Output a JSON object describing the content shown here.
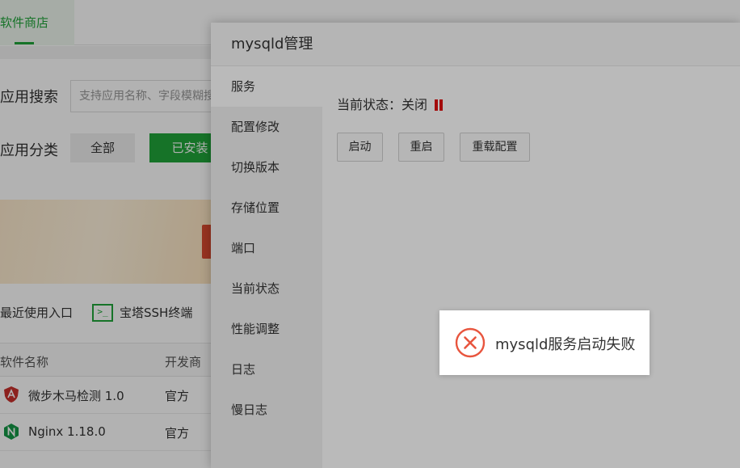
{
  "background": {
    "tab_label": "软件商店",
    "search_label": "应用搜索",
    "search_placeholder": "支持应用名称、字段模糊搜索",
    "category_label": "应用分类",
    "category_all": "全部",
    "category_installed": "已安装",
    "recent_entry": "最近使用入口",
    "ssh_icon_text": ">_",
    "ssh_label": "宝塔SSH终端",
    "table_headers": [
      "软件名称",
      "开发商"
    ],
    "rows": [
      {
        "name": "微步木马检测 1.0",
        "vendor": "官方",
        "icon": "shield-icon",
        "icon_color": "#c9302c"
      },
      {
        "name": "Nginx 1.18.0",
        "vendor": "官方",
        "icon": "nginx-icon",
        "icon_color": "#159947"
      }
    ],
    "accent_color": "#20a53a"
  },
  "dialog": {
    "title": "mysqld管理",
    "side_items": [
      "服务",
      "配置修改",
      "切换版本",
      "存储位置",
      "端口",
      "当前状态",
      "性能调整",
      "日志",
      "慢日志"
    ],
    "active_index": 0,
    "status_label": "当前状态：",
    "status_value": "关闭",
    "status_icon": "pause-icon",
    "status_color": "#e01010",
    "buttons": {
      "start": "启动",
      "restart": "重启",
      "reload": "重载配置"
    }
  },
  "toast": {
    "icon": "error-circle-icon",
    "icon_color": "#e8553e",
    "message": "mysqld服务启动失败"
  }
}
